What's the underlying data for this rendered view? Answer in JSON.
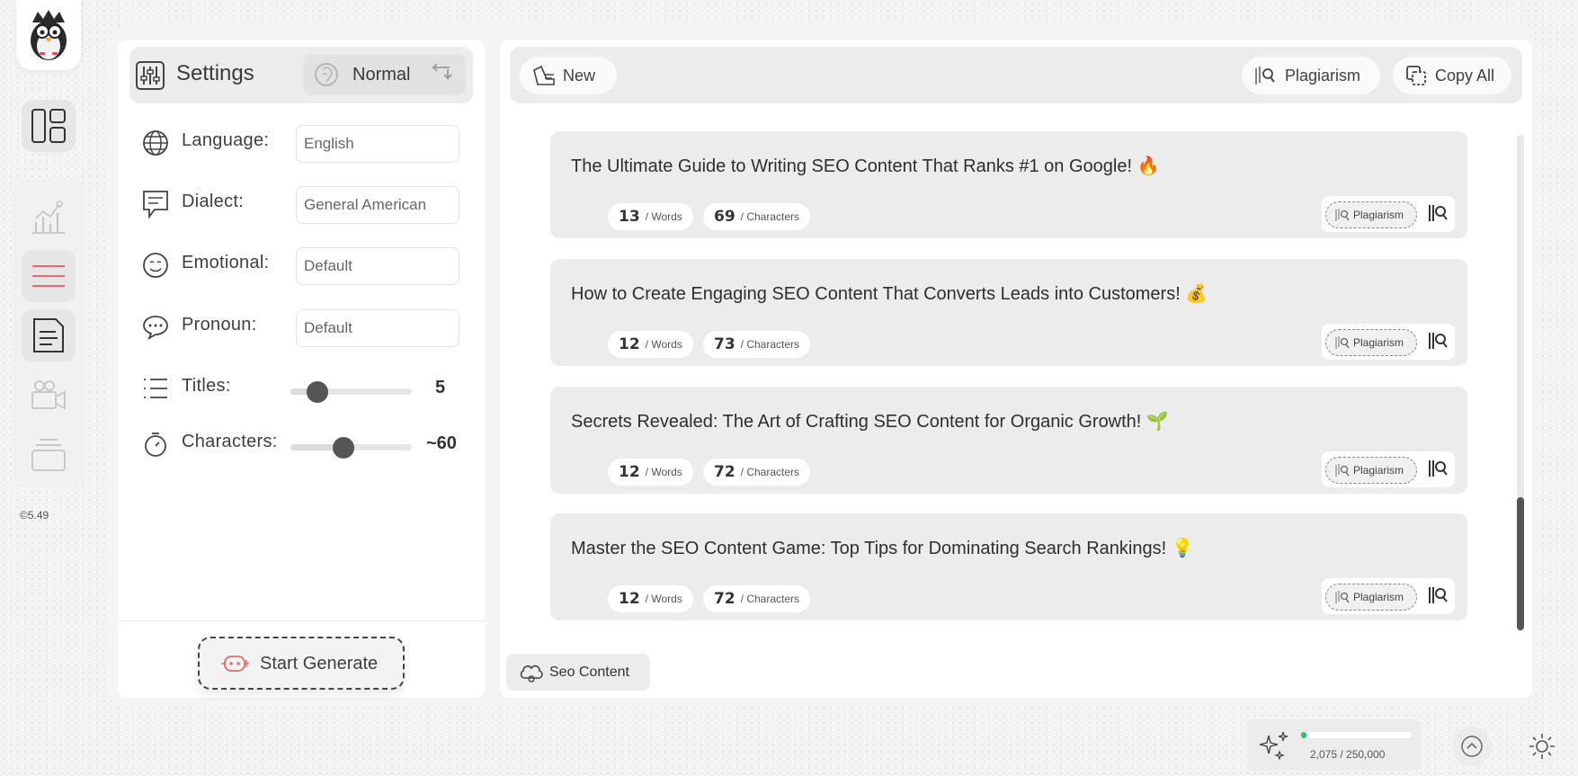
{
  "app": {
    "version": "©5.49"
  },
  "settings": {
    "title": "Settings",
    "mode": "Normal",
    "fields": [
      {
        "label": "Language:",
        "value": "English",
        "icon": "globe-icon"
      },
      {
        "label": "Dialect:",
        "value": "General American",
        "icon": "speech-bubble-icon"
      },
      {
        "label": "Emotional:",
        "value": "Default",
        "icon": "face-icon"
      },
      {
        "label": "Pronoun:",
        "value": "Default",
        "icon": "chat-dots-icon"
      }
    ],
    "titles": {
      "label": "Titles:",
      "value": "5",
      "level": 0.22
    },
    "characters": {
      "label": "Characters:",
      "value": "~60",
      "level": 0.44
    },
    "start_label": "Start Generate"
  },
  "toolbar": {
    "new_label": "New",
    "plagiarism_label": "Plagiarism",
    "copy_all_label": "Copy All"
  },
  "results": [
    {
      "title": "The Ultimate Guide to Writing SEO Content That Ranks #1 on Google! 🔥",
      "words": "13",
      "words_unit": "/ Words",
      "chars": "69",
      "chars_unit": "/ Characters",
      "plagiarism": "Plagiarism"
    },
    {
      "title": "How to Create Engaging SEO Content That Converts Leads into Customers! 💰",
      "words": "12",
      "words_unit": "/ Words",
      "chars": "73",
      "chars_unit": "/ Characters",
      "plagiarism": "Plagiarism"
    },
    {
      "title": "Secrets Revealed: The Art of Crafting SEO Content for Organic Growth! 🌱",
      "words": "12",
      "words_unit": "/ Words",
      "chars": "72",
      "chars_unit": "/ Characters",
      "plagiarism": "Plagiarism"
    },
    {
      "title": "Master the SEO Content Game: Top Tips for Dominating Search Rankings! 💡",
      "words": "12",
      "words_unit": "/ Words",
      "chars": "72",
      "chars_unit": "/ Characters",
      "plagiarism": "Plagiarism"
    }
  ],
  "tab": {
    "label": "Seo Content"
  },
  "usage": {
    "text": "2,075 / 250,000",
    "fraction": 0.0083
  },
  "colors": {
    "accent": "#27c26a",
    "danger": "#e86a6a"
  }
}
